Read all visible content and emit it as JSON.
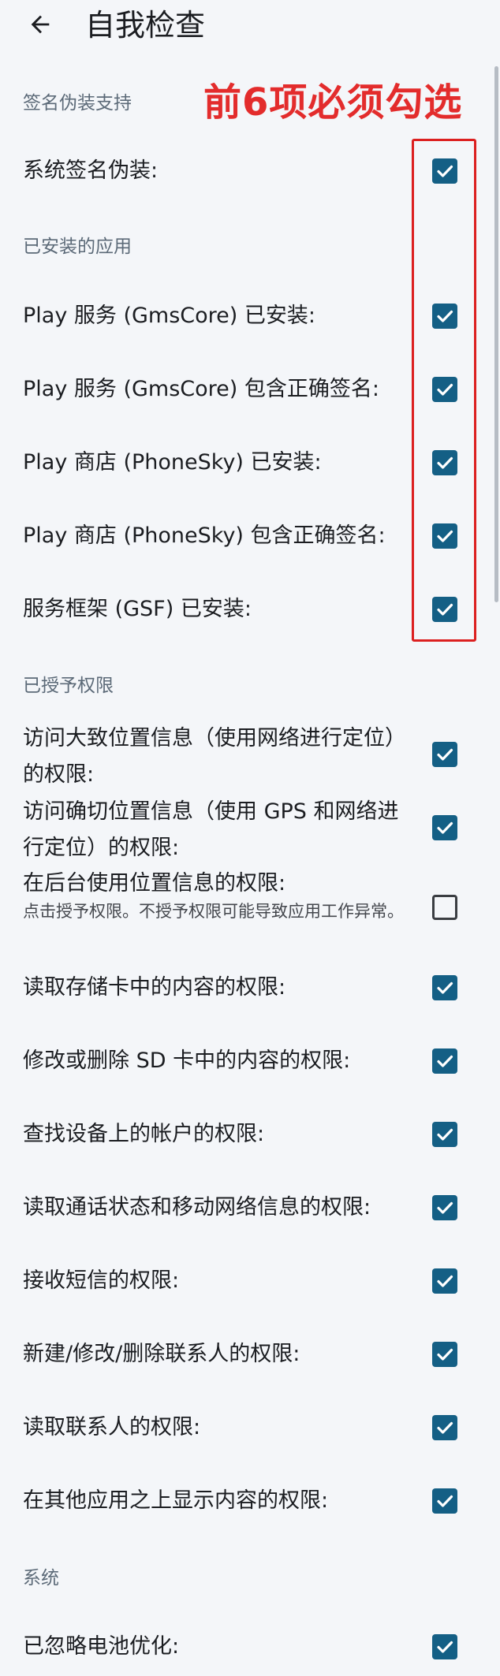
{
  "app": {
    "title": "自我检查"
  },
  "annotation": {
    "text": "前6项必须勾选",
    "color": "#e32c2c"
  },
  "colors": {
    "checkbox_checked": "#145f85",
    "background": "#f4f6f9",
    "section_header": "#5c6a78"
  },
  "sections": {
    "signature_spoofing": {
      "header": "签名伪装支持",
      "rows": [
        {
          "label": "系统签名伪装:",
          "checked": true
        }
      ]
    },
    "installed_apps": {
      "header": "已安装的应用",
      "rows": [
        {
          "label": "Play 服务 (GmsCore) 已安装:",
          "checked": true
        },
        {
          "label": "Play 服务 (GmsCore) 包含正确签名:",
          "checked": true
        },
        {
          "label": "Play 商店 (PhoneSky) 已安装:",
          "checked": true
        },
        {
          "label": "Play 商店 (PhoneSky) 包含正确签名:",
          "checked": true
        },
        {
          "label": "服务框架 (GSF) 已安装:",
          "checked": true
        }
      ]
    },
    "permissions": {
      "header": "已授予权限",
      "rows": [
        {
          "label": "访问大致位置信息（使用网络进行定位）的权限:",
          "checked": true
        },
        {
          "label": "访问确切位置信息（使用 GPS 和网络进行定位）的权限:",
          "checked": true
        },
        {
          "label": "在后台使用位置信息的权限:",
          "sublabel": "点击授予权限。不授予权限可能导致应用工作异常。",
          "checked": false
        },
        {
          "label": "读取存储卡中的内容的权限:",
          "checked": true
        },
        {
          "label": "修改或删除 SD 卡中的内容的权限:",
          "checked": true
        },
        {
          "label": "查找设备上的帐户的权限:",
          "checked": true
        },
        {
          "label": "读取通话状态和移动网络信息的权限:",
          "checked": true
        },
        {
          "label": "接收短信的权限:",
          "checked": true
        },
        {
          "label": "新建/修改/删除联系人的权限:",
          "checked": true
        },
        {
          "label": "读取联系人的权限:",
          "checked": true
        },
        {
          "label": "在其他应用之上显示内容的权限:",
          "checked": true
        }
      ]
    },
    "system": {
      "header": "系统",
      "rows": [
        {
          "label": "已忽略电池优化:",
          "checked": true
        }
      ]
    }
  }
}
